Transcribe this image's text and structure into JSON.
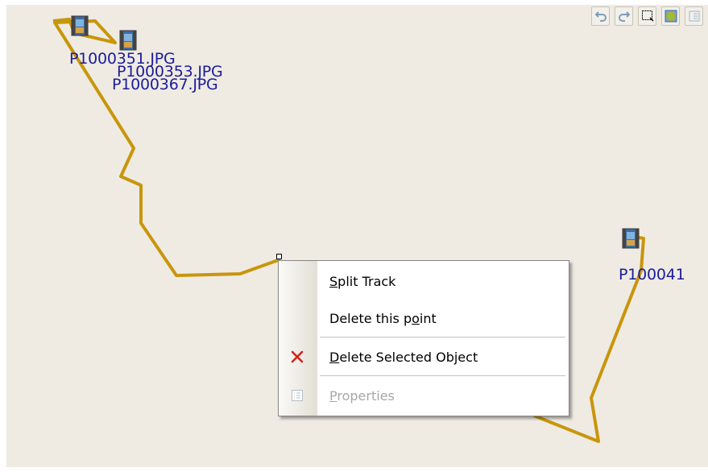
{
  "map": {
    "photos": [
      {
        "label": "P1000351.JPG"
      },
      {
        "label": "P1000353.JPG"
      },
      {
        "label": "P1000367.JPG"
      },
      {
        "label": "P100041"
      }
    ],
    "track_color": "#c8960c",
    "label_color": "#1c1c9a"
  },
  "toolbar": {
    "buttons": [
      "undo-icon",
      "redo-icon",
      "select-area-icon",
      "edit-map-icon",
      "properties-icon"
    ]
  },
  "context_menu": {
    "split_track": {
      "pre": "",
      "key": "S",
      "post": "plit Track"
    },
    "delete_point": {
      "pre": "Delete this p",
      "key": "o",
      "post": "int"
    },
    "delete_selected": {
      "pre": "",
      "key": "D",
      "post": "elete Selected Object"
    },
    "properties": {
      "pre": "",
      "key": "P",
      "post": "roperties"
    }
  }
}
